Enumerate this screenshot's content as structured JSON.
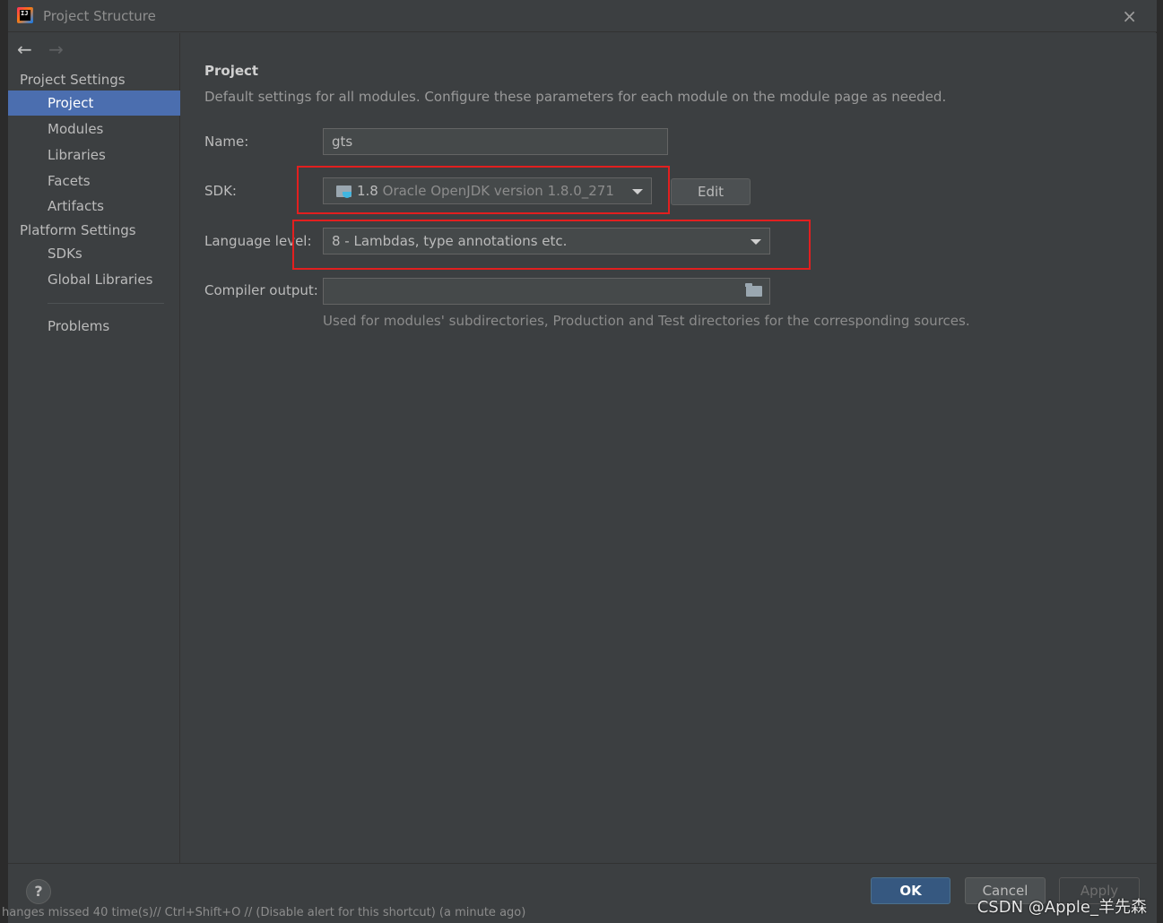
{
  "window": {
    "title": "Project Structure",
    "app_icon": "intellij-idea-icon",
    "close": "×"
  },
  "nav": {
    "back": "←",
    "forward": "→"
  },
  "sidebar": {
    "project_settings_title": "Project Settings",
    "project_settings_items": [
      {
        "label": "Project",
        "active": true
      },
      {
        "label": "Modules"
      },
      {
        "label": "Libraries"
      },
      {
        "label": "Facets"
      },
      {
        "label": "Artifacts"
      }
    ],
    "platform_settings_title": "Platform Settings",
    "platform_settings_items": [
      {
        "label": "SDKs"
      },
      {
        "label": "Global Libraries"
      }
    ],
    "problems": "Problems"
  },
  "main": {
    "title": "Project",
    "description": "Default settings for all modules. Configure these parameters for each module on the module page as needed.",
    "name_label": "Name:",
    "name_value": "gts",
    "sdk_label": "SDK:",
    "sdk_version": "1.8",
    "sdk_description": "Oracle OpenJDK version 1.8.0_271",
    "sdk_edit": "Edit",
    "language_level_label": "Language level:",
    "language_level_value": "8 - Lambdas, type annotations etc.",
    "compiler_output_label": "Compiler output:",
    "compiler_output_value": "",
    "compiler_output_hint": "Used for modules' subdirectories, Production and Test directories for the corresponding sources."
  },
  "footer": {
    "help": "?",
    "ok": "OK",
    "cancel": "Cancel",
    "apply": "Apply"
  },
  "statusbar": "hanges missed 40 time(s)// Ctrl+Shift+O // (Disable alert for this shortcut) (a minute ago)",
  "watermark": "CSDN @Apple_羊先森",
  "colors": {
    "selection": "#4b6eaf",
    "highlight_box": "#e21f1f",
    "ok_button": "#365880"
  }
}
